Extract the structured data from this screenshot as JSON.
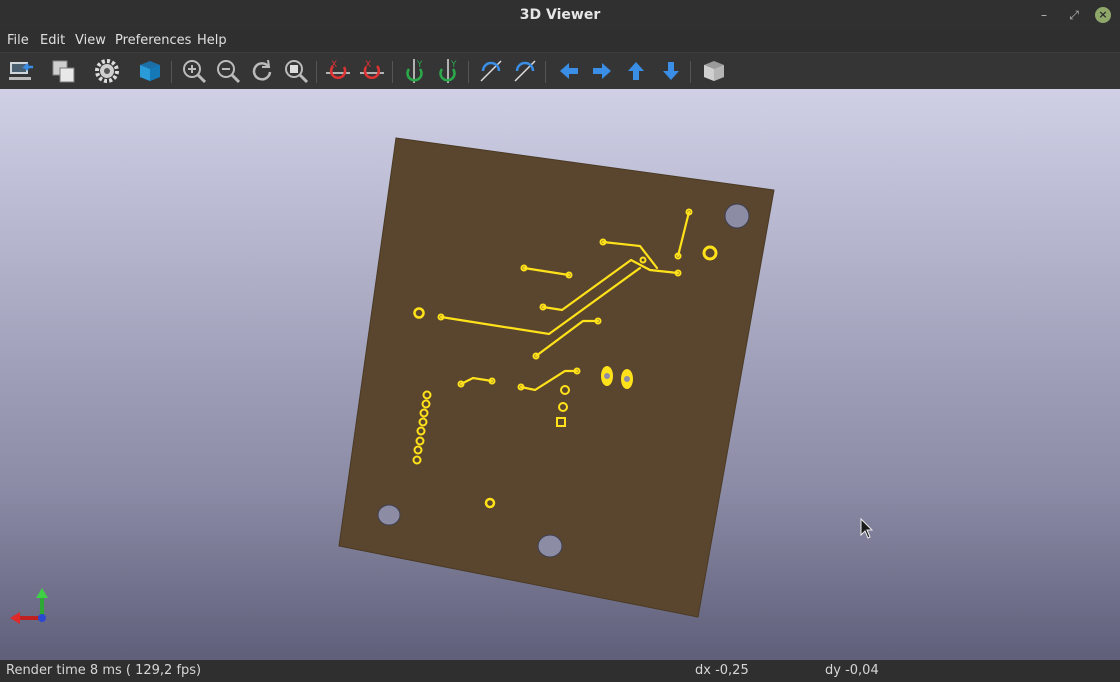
{
  "window": {
    "title": "3D Viewer"
  },
  "menu": [
    "File",
    "Edit",
    "View",
    "Preferences",
    "Help"
  ],
  "toolbar": {
    "buttons": [
      "reload-board-icon",
      "copy-image-icon",
      "settings-gear-icon",
      "render-mode-cube-icon",
      "zoom-in-icon",
      "zoom-out-icon",
      "redraw-icon",
      "zoom-fit-icon",
      "rotate-x-cw-icon",
      "rotate-x-ccw-icon",
      "rotate-y-cw-icon",
      "rotate-y-ccw-icon",
      "rotate-z-cw-icon",
      "rotate-z-ccw-icon",
      "move-left-icon",
      "move-right-icon",
      "move-up-icon",
      "move-down-icon",
      "ortho-view-cube-icon"
    ]
  },
  "colors": {
    "board": "#5a462e",
    "copper": "#ffe21a",
    "holes": "#8c8ca4"
  },
  "status": {
    "render_time": "Render time 8 ms ( 129,2 fps)",
    "dx": "dx -0,25",
    "dy": "dy -0,04"
  }
}
